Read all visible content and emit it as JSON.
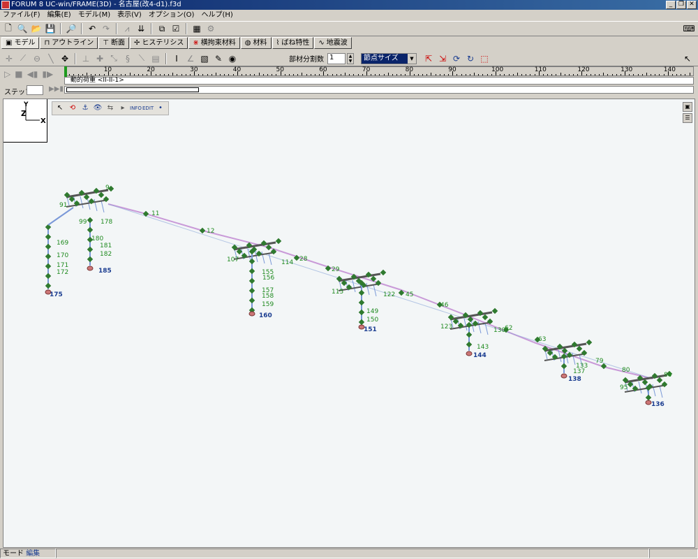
{
  "window": {
    "title": "FORUM 8  UC-win/FRAME(3D) - 名古屋(改4-d1).f3d",
    "minimize": "_",
    "maximize": "❐",
    "close": "✕"
  },
  "menu": [
    "ファイル(F)",
    "編集(E)",
    "モデル(M)",
    "表示(V)",
    "オプション(O)",
    "ヘルプ(H)"
  ],
  "tabs": [
    {
      "label": "モデル",
      "icon": "model-icon",
      "active": true
    },
    {
      "label": "アウトライン",
      "icon": "outline-icon"
    },
    {
      "label": "断面",
      "icon": "section-icon"
    },
    {
      "label": "ヒステリシス",
      "icon": "hysteresis-icon"
    },
    {
      "label": "横拘束材料",
      "icon": "confinement-icon"
    },
    {
      "label": "材料",
      "icon": "material-icon"
    },
    {
      "label": "ばね特性",
      "icon": "spring-icon"
    },
    {
      "label": "地震波",
      "icon": "wave-icon"
    }
  ],
  "toolbar2": {
    "division_label": "部材分割数",
    "division_value": "1",
    "size_combo": "節点サイズ"
  },
  "timeline": {
    "ticks": [
      "10",
      "20",
      "30",
      "40",
      "50",
      "60",
      "70",
      "80",
      "90",
      "100",
      "110",
      "120",
      "130",
      "140"
    ],
    "load_case": "動的荷重 <II-II-1>",
    "step_label": "ステップ:",
    "step_value": ""
  },
  "axes": {
    "y": "Y",
    "z": "Z",
    "x": "X"
  },
  "status": {
    "mode_label": "モード",
    "mode_value": "編集"
  },
  "colors": {
    "node": "#2f7a2f",
    "label": "#1f8a1f",
    "support_label": "#1a3c90",
    "beam": "#c99ad8"
  },
  "model": {
    "node_labels": [
      {
        "t": "9"
      },
      {
        "t": "91"
      },
      {
        "t": "99"
      },
      {
        "t": "178"
      },
      {
        "t": "180"
      },
      {
        "t": "181"
      },
      {
        "t": "182"
      },
      {
        "t": "169"
      },
      {
        "t": "170"
      },
      {
        "t": "171"
      },
      {
        "t": "172"
      },
      {
        "t": "11"
      },
      {
        "t": "12"
      },
      {
        "t": "107"
      },
      {
        "t": "114"
      },
      {
        "t": "155"
      },
      {
        "t": "156"
      },
      {
        "t": "157"
      },
      {
        "t": "158"
      },
      {
        "t": "159"
      },
      {
        "t": "28"
      },
      {
        "t": "29"
      },
      {
        "t": "115"
      },
      {
        "t": "122"
      },
      {
        "t": "149"
      },
      {
        "t": "150"
      },
      {
        "t": "45"
      },
      {
        "t": "46"
      },
      {
        "t": "123"
      },
      {
        "t": "143"
      },
      {
        "t": "62"
      },
      {
        "t": "63"
      },
      {
        "t": "130"
      },
      {
        "t": "133"
      },
      {
        "t": "137"
      },
      {
        "t": "79"
      },
      {
        "t": "80"
      },
      {
        "t": "84"
      },
      {
        "t": "95"
      }
    ],
    "support_labels": [
      {
        "t": "175"
      },
      {
        "t": "185"
      },
      {
        "t": "160"
      },
      {
        "t": "151"
      },
      {
        "t": "144"
      },
      {
        "t": "138"
      },
      {
        "t": "136"
      }
    ]
  }
}
